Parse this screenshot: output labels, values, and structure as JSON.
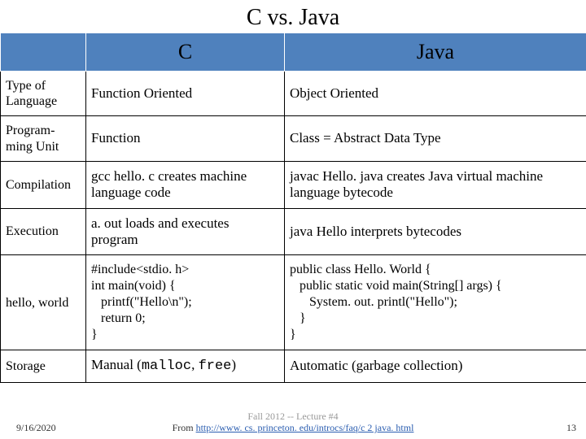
{
  "title": "C vs. Java",
  "headers": {
    "blank": "",
    "c": "C",
    "java": "Java"
  },
  "rows": [
    {
      "label": "Type of Language",
      "c": "Function Oriented",
      "java": "Object Oriented"
    },
    {
      "label": "Program-\nming Unit",
      "c": "Function",
      "java": "Class = Abstract Data Type"
    },
    {
      "label": "Compilation",
      "c": "gcc hello. c creates machine language code",
      "java": "javac Hello. java creates Java virtual machine language bytecode"
    },
    {
      "label": "Execution",
      "c": "a. out loads and executes program",
      "java": "java Hello interprets bytecodes"
    },
    {
      "label": "hello, world",
      "c": "#include<stdio. h>\nint main(void) {\n   printf(\"Hello\\n\");\n   return 0;\n}",
      "java": "public class Hello. World {\n   public static void main(String[] args) {\n      System. out. printl(\"Hello\");\n   }\n}"
    },
    {
      "label": "Storage",
      "c_prefix": "Manual (",
      "c_mono1": "malloc",
      "c_mid": ", ",
      "c_mono2": "free",
      "c_suffix": ")",
      "java": "Automatic (garbage collection)"
    }
  ],
  "footer": {
    "date": "9/16/2020",
    "mid": "Fall 2012 -- Lecture #4",
    "src_prefix": "From ",
    "src_url": "http://www. cs. princeton. edu/introcs/faq/c 2 java. html",
    "page": "13"
  }
}
